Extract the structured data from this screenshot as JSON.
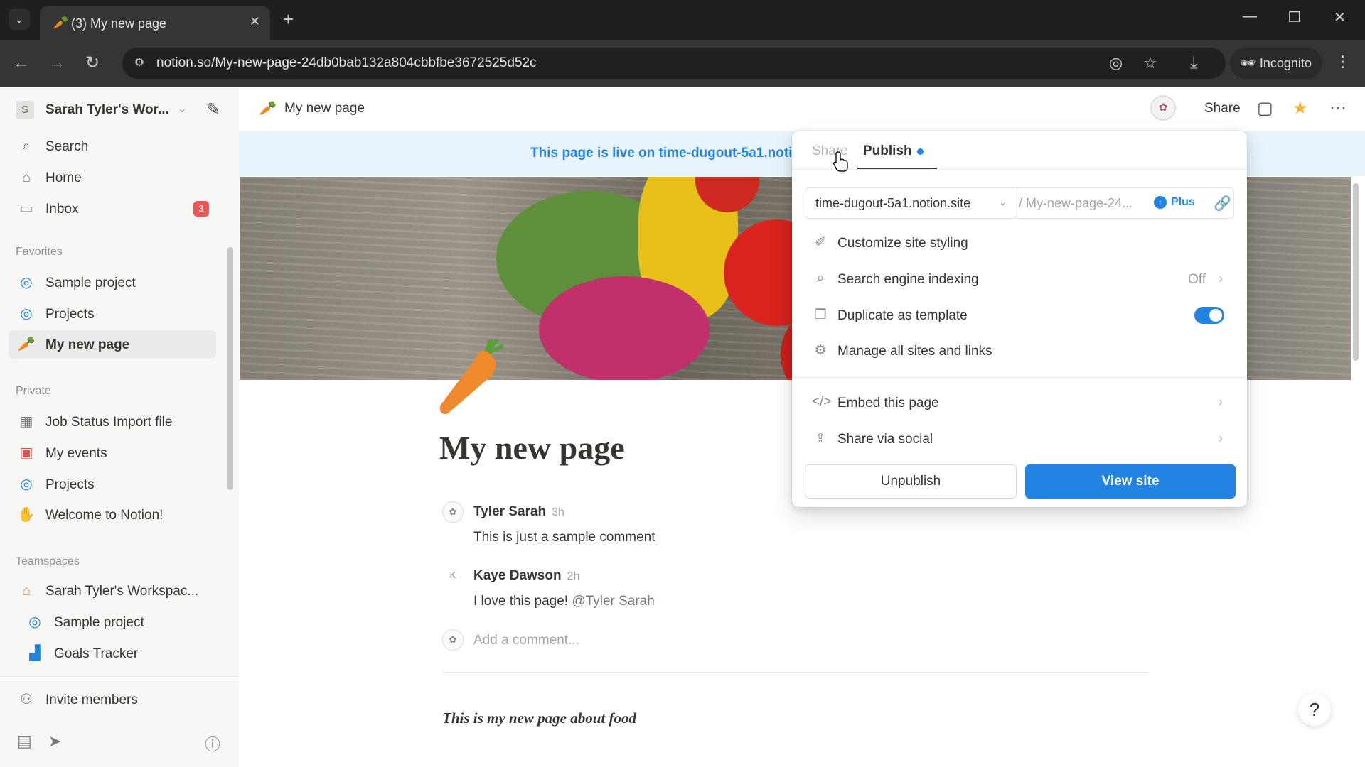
{
  "browser": {
    "tab_title": "(3) My new page",
    "url": "notion.so/My-new-page-24db0bab132a804cbbfbe3672525d52c",
    "incognito_label": "Incognito"
  },
  "sidebar": {
    "workspace_initial": "S",
    "workspace_name": "Sarah Tyler's Wor...",
    "top_items": [
      {
        "label": "Search",
        "icon": "search-icon"
      },
      {
        "label": "Home",
        "icon": "home-icon"
      },
      {
        "label": "Inbox",
        "icon": "inbox-icon",
        "badge": "3"
      }
    ],
    "favorites_heading": "Favorites",
    "favorites": [
      {
        "label": "Sample project",
        "icon": "project-icon"
      },
      {
        "label": "Projects",
        "icon": "project-icon"
      },
      {
        "label": "My new page",
        "icon": "carrot-icon",
        "active": true
      }
    ],
    "private_heading": "Private",
    "private": [
      {
        "label": "Job Status Import file",
        "icon": "table-icon"
      },
      {
        "label": "My events",
        "icon": "calendar-icon"
      },
      {
        "label": "Projects",
        "icon": "project-icon"
      },
      {
        "label": "Welcome to Notion!",
        "icon": "wave-icon"
      }
    ],
    "teamspaces_heading": "Teamspaces",
    "teamspace_name": "Sarah Tyler's Workspac...",
    "teamspace_items": [
      {
        "label": "Sample project",
        "icon": "project-icon"
      },
      {
        "label": "Goals Tracker",
        "icon": "chart-icon"
      }
    ],
    "invite_label": "Invite members"
  },
  "topbar": {
    "breadcrumb": "My new page",
    "share_label": "Share"
  },
  "banner": {
    "text": "This page is live on time-dugout-5a1.notio"
  },
  "page": {
    "title": "My new page",
    "comments": [
      {
        "avatar": "✿",
        "author": "Tyler Sarah",
        "time": "3h",
        "text": "This is just a sample comment",
        "mention": ""
      },
      {
        "avatar": "K",
        "author": "Kaye Dawson",
        "time": "2h",
        "text": "I love this page! ",
        "mention": "@Tyler Sarah"
      }
    ],
    "add_comment_placeholder": "Add a comment...",
    "body_text": "This is my new page about food"
  },
  "publish_popover": {
    "tab_share": "Share",
    "tab_publish": "Publish",
    "domain": "time-dugout-5a1.notion.site",
    "path": "/ My-new-page-24...",
    "plus_label": "Plus",
    "rows": [
      {
        "label": "Customize site styling",
        "icon": "paint-icon"
      },
      {
        "label": "Search engine indexing",
        "icon": "search-icon",
        "value": "Off"
      },
      {
        "label": "Duplicate as template",
        "icon": "duplicate-icon",
        "toggle": true
      },
      {
        "label": "Manage all sites and links",
        "icon": "gear-icon"
      },
      {
        "label": "Embed this page",
        "icon": "code-icon"
      },
      {
        "label": "Share via social",
        "icon": "share-icon"
      }
    ],
    "unpublish_label": "Unpublish",
    "view_site_label": "View site"
  },
  "colors": {
    "accent": "#2383e2",
    "badge": "#eb5757",
    "banner_bg": "#e9f3fb"
  }
}
